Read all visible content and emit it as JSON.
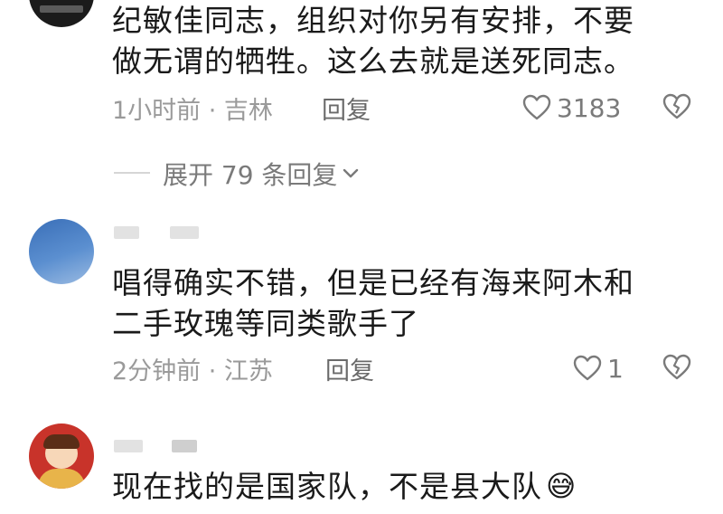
{
  "comments": [
    {
      "text_lines": [
        "纪敏佳同志，组织对你另有安排，不要",
        "做无谓的牺牲。这么去就是送死同志。"
      ],
      "time_location": "1小时前 · 吉林",
      "reply_label": "回复",
      "like_count": "3183"
    },
    {
      "text_lines": [
        "唱得确实不错，但是已经有海来阿木和",
        "二手玫瑰等同类歌手了"
      ],
      "time_location": "2分钟前 · 江苏",
      "reply_label": "回复",
      "like_count": "1"
    },
    {
      "text_lines": [
        "现在找的是国家队，不是县大队"
      ],
      "emoji": "😅"
    }
  ],
  "expand_replies": {
    "label": "展开 79 条回复"
  },
  "icons": [
    "heart-icon",
    "broken-heart-icon",
    "chevron-down-icon"
  ],
  "colors": {
    "text": "#1a1a1a",
    "meta": "#9a9a9a",
    "background": "#ffffff"
  }
}
